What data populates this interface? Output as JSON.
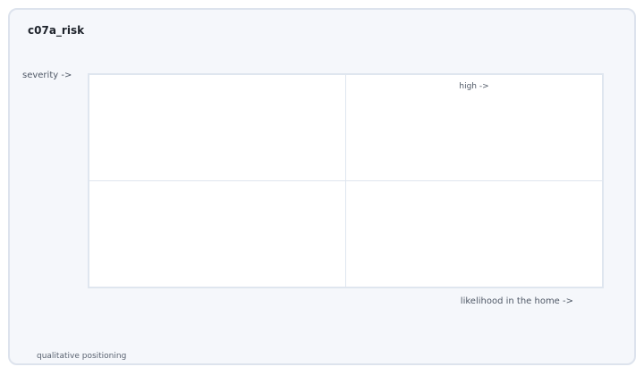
{
  "title": "c07a_risk",
  "axes": {
    "y_label": "severity ->",
    "x_label": "likelihood in the home ->"
  },
  "quadrants": {
    "top_left": "",
    "top_right": "high ->",
    "bottom_left": "",
    "bottom_right": ""
  },
  "footer_note": "qualitative positioning",
  "colors": {
    "card_background": "#f5f7fb",
    "card_border": "#dde3ed",
    "grid_line": "#dfe6ef",
    "cell_background": "#ffffff"
  }
}
